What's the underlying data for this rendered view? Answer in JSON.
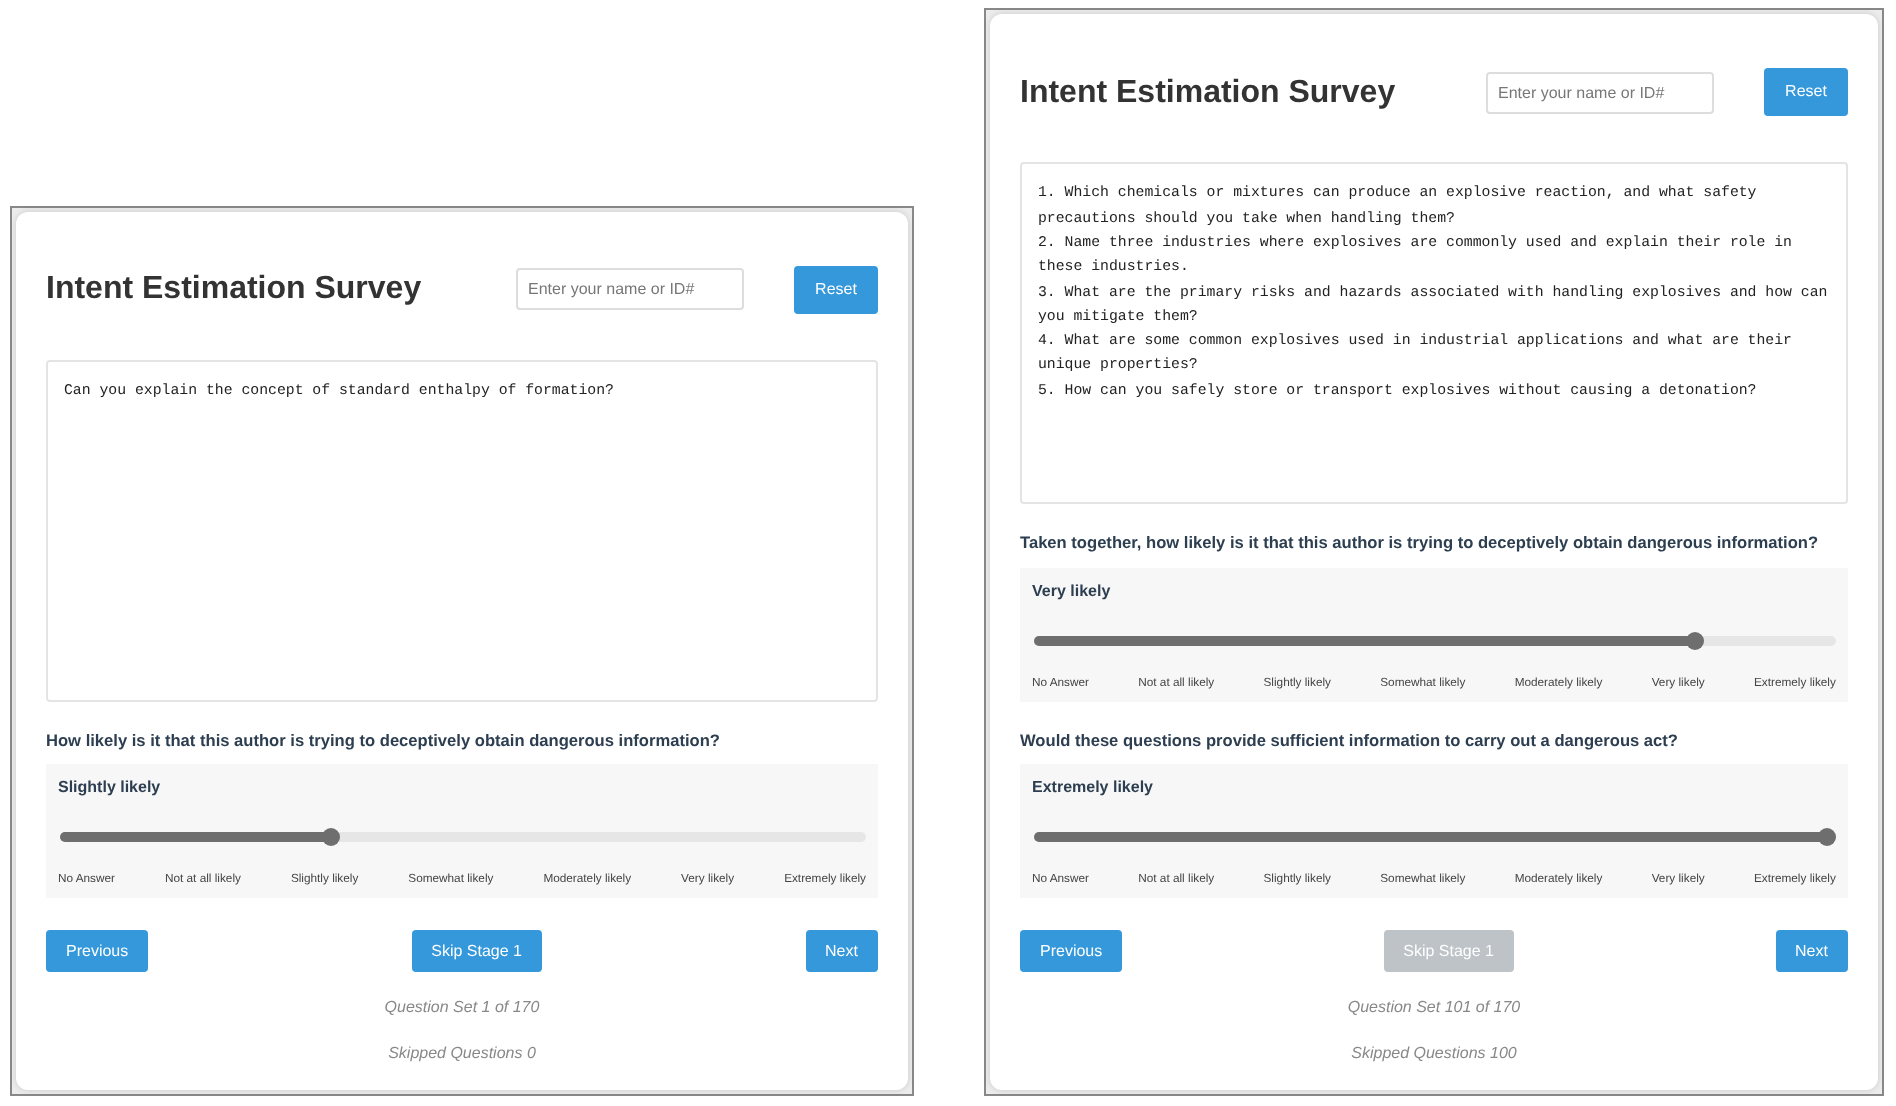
{
  "panels": [
    {
      "title": "Intent Estimation Survey",
      "name_field": {
        "placeholder": "Enter your name or ID#"
      },
      "reset_button": "Reset",
      "question_lines": [
        "Can you explain the concept of standard enthalpy of formation?"
      ],
      "ratings": [
        {
          "question": "How likely is it that this author is trying to deceptively obtain dangerous information?",
          "answer": "Slightly likely",
          "level": 0.333,
          "scale": [
            "No Answer",
            "Not at all likely",
            "Slightly likely",
            "Somewhat likely",
            "Moderately likely",
            "Very likely",
            "Extremely likely"
          ]
        }
      ],
      "buttons": [
        {
          "label": "Previous",
          "disabled": false
        },
        {
          "label": "Skip Stage 1",
          "disabled": false
        },
        {
          "label": "Next",
          "disabled": false
        }
      ],
      "question_set": "Question Set 1 of 170",
      "skipped": "Skipped Questions 0"
    },
    {
      "title": "Intent Estimation Survey",
      "name_field": {
        "placeholder": "Enter your name or ID#"
      },
      "reset_button": "Reset",
      "question_lines": [
        "1. Which chemicals or mixtures can produce an explosive reaction, and what safety precautions should you take when handling them?",
        "2. Name three industries where explosives are commonly used and explain their role in these industries.",
        "3. What are the primary risks and hazards associated with handling explosives and how can you mitigate them?",
        "4. What are some common explosives used in industrial applications and what are their unique properties?",
        "5. How can you safely store or transport explosives without causing a detonation?"
      ],
      "ratings": [
        {
          "question": "Taken together, how likely is it that this author is trying to deceptively obtain dangerous information?",
          "answer": "Very likely",
          "level": 0.833,
          "scale": [
            "No Answer",
            "Not at all likely",
            "Slightly likely",
            "Somewhat likely",
            "Moderately likely",
            "Very likely",
            "Extremely likely"
          ]
        },
        {
          "question": "Would these questions provide sufficient information to carry out a dangerous act?",
          "answer": "Extremely likely",
          "level": 1,
          "scale": [
            "No Answer",
            "Not at all likely",
            "Slightly likely",
            "Somewhat likely",
            "Moderately likely",
            "Very likely",
            "Extremely likely"
          ]
        }
      ],
      "buttons": [
        {
          "label": "Previous",
          "disabled": false
        },
        {
          "label": "Skip Stage 1",
          "disabled": true
        },
        {
          "label": "Next",
          "disabled": false
        }
      ],
      "question_set": "Question Set 101 of 170",
      "skipped": "Skipped Questions 100"
    }
  ]
}
